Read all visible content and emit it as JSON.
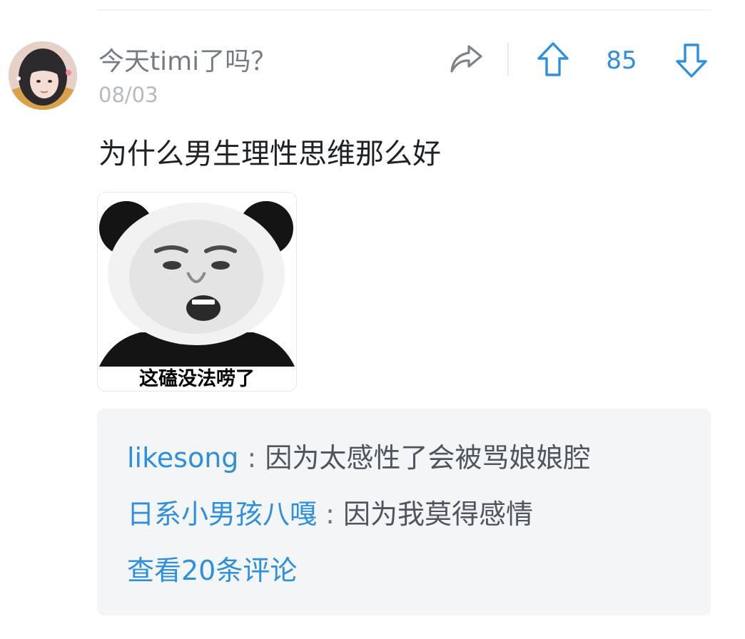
{
  "post": {
    "username": "今天timi了吗？",
    "date": "08/03",
    "text": "为什么男生理性思维那么好",
    "image_caption": "这磕没法唠了",
    "vote_count": "85"
  },
  "actions": {
    "share_icon": "share-icon",
    "upvote_icon": "arrow-up-icon",
    "downvote_icon": "arrow-down-icon"
  },
  "comments": [
    {
      "user": "likesong",
      "separator": ":",
      "text": "因为太感性了会被骂娘娘腔"
    },
    {
      "user": "日系小男孩八嘎",
      "separator": ":",
      "text": "因为我莫得感情"
    }
  ],
  "view_all_comments": "查看20条评论",
  "colors": {
    "accent": "#2d8fe0",
    "username": "#747b84",
    "date": "#b5bac1",
    "comment_bg": "#f4f5f7"
  }
}
